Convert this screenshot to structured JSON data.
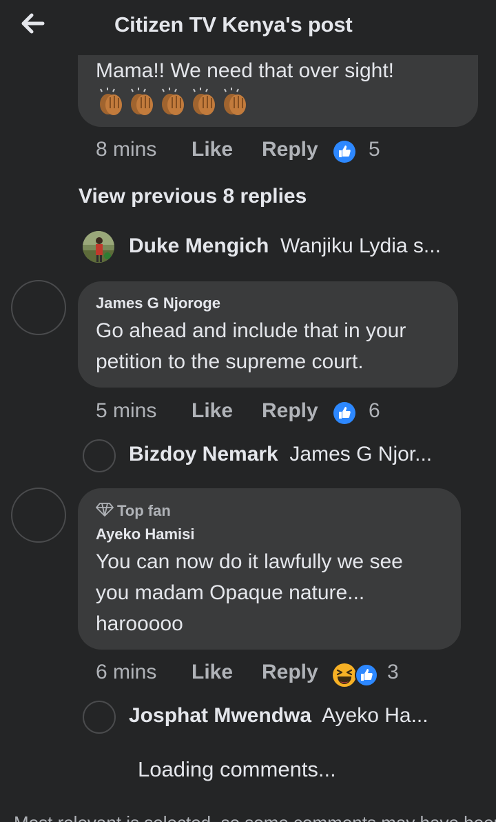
{
  "header": {
    "title": "Citizen TV Kenya's post"
  },
  "comment1": {
    "text": "Mama!! We need that over sight!",
    "emoji_count": 5,
    "time": "8 mins",
    "like": "Like",
    "reply": "Reply",
    "reactions": "5"
  },
  "view_previous": "View previous 8 replies",
  "reply1": {
    "name": "Duke Mengich",
    "text": "Wanjiku Lydia s..."
  },
  "comment2": {
    "author": "James G Njoroge",
    "line1": "Go ahead and include that in your",
    "line2": "petition to the supreme court.",
    "time": "5 mins",
    "like": "Like",
    "reply": "Reply",
    "reactions": "6"
  },
  "reply2": {
    "name": "Bizdoy Nemark",
    "text": "James G Njor..."
  },
  "comment3": {
    "badge": "Top fan",
    "author": "Ayeko Hamisi",
    "line1": "You can now do it lawfully we see",
    "line2": "you madam Opaque nature...",
    "line3": "harooooo",
    "time": "6 mins",
    "like": "Like",
    "reply": "Reply",
    "reactions": "3"
  },
  "reply3": {
    "name": "Josphat Mwendwa",
    "text": "Ayeko Ha..."
  },
  "loading": "Loading comments...",
  "footer_clip": "Most relevant is selected, so some comments may have been",
  "colors": {
    "background": "#242526",
    "bubble": "#3a3b3c",
    "like_blue": "#2d88ff",
    "muted": "#b0b3b8"
  }
}
